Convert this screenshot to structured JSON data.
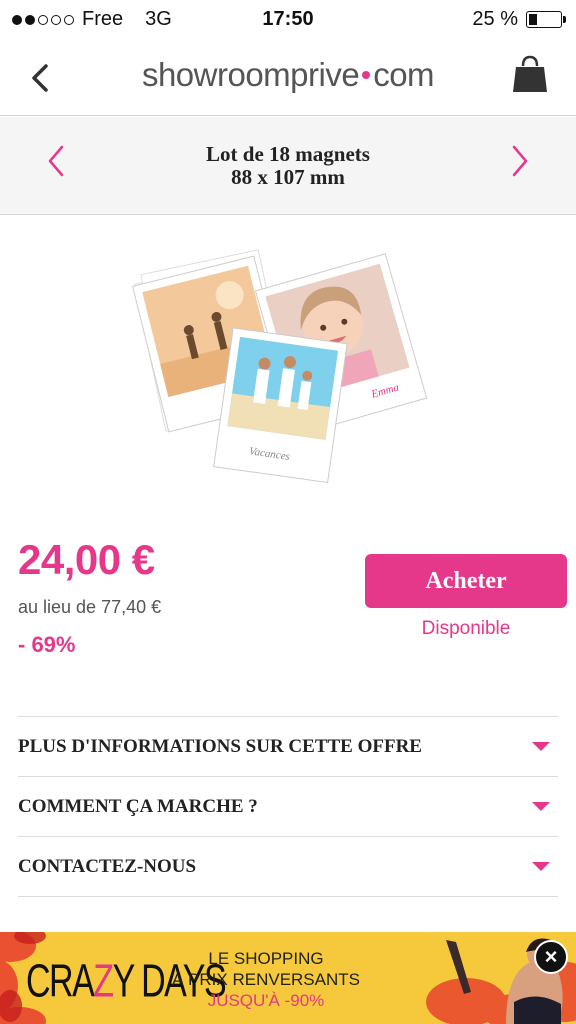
{
  "status_bar": {
    "carrier": "Free",
    "network": "3G",
    "time": "17:50",
    "battery": "25 %",
    "battery_level": 0.25
  },
  "navbar": {
    "logo_part1": "showroomprive",
    "logo_part2": "com",
    "back_icon": "chevron-left-icon",
    "bag_icon": "shopping-bag-icon"
  },
  "product": {
    "title_line1": "Lot de 18 magnets",
    "title_line2": "88 x 107 mm",
    "image_captions": [
      "Vacances",
      "Emma"
    ],
    "price": "24,00 €",
    "original_price": "au lieu de 77,40 €",
    "discount": "- 69%",
    "buy_label": "Acheter",
    "availability": "Disponible"
  },
  "accordion": [
    {
      "label": "PLUS D'INFORMATIONS SUR CETTE OFFRE"
    },
    {
      "label": "COMMENT ÇA MARCHE ?"
    },
    {
      "label": "CONTACTEZ-NOUS"
    }
  ],
  "banner": {
    "brand_a": "CRA",
    "brand_z": "Z",
    "brand_b": "Y DAYS",
    "line1": "LE SHOPPING",
    "line2": "À PRIX RENVERSANTS",
    "line3": "JUSQU'À -90%",
    "close_label": "×"
  },
  "colors": {
    "accent": "#e5388a",
    "banner_bg": "#f6c93c",
    "header_bg": "#f5f5f5"
  }
}
